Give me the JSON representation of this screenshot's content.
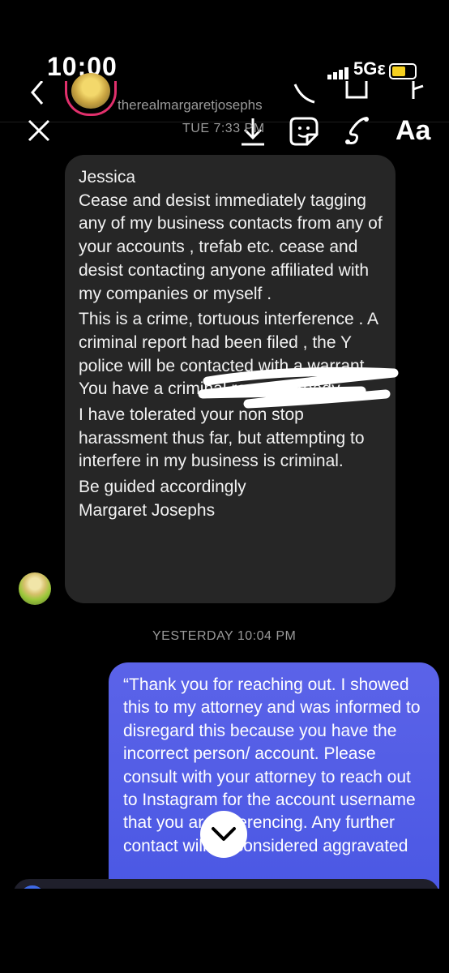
{
  "status_bar": {
    "time": "10:00",
    "network": "5Gε",
    "battery_fraction": 0.6
  },
  "header": {
    "username": "therealmargaretjosephs"
  },
  "story_tools": {
    "text_tool": "Aa"
  },
  "timestamps": {
    "first": "TUE 7:33 PM",
    "second": "YESTERDAY 10:04 PM"
  },
  "incoming_message": {
    "paragraphs": [
      "Jessica",
      "Cease and desist immediately tagging any of my business contacts from any of your accounts , trefab etc. cease and desist contacting anyone affiliated with my companies or myself .",
      "This is a crime, tortuous interference . A criminal report had been filed , the Y      police will be contacted with a warrant . You have a criminal record already .",
      "I have tolerated your non stop harassment thus far, but attempting to interfere in my business is criminal.",
      "Be guided accordingly\nMargaret Josephs"
    ]
  },
  "outgoing_message": {
    "text": "“Thank you for reaching out. I showed this to my attorney and was informed to disregard this because you have the incorrect person/ account. Please consult with your attorney to reach out to Instagram for the account username that you are referencing. Any further contact will be considered aggravated"
  },
  "colors": {
    "incoming_bubble": "#262626",
    "outgoing_bubble": "#4b58e4",
    "background": "#000000",
    "muted_text": "#9a9a9a"
  },
  "icons": [
    "back-chevron-icon",
    "close-icon",
    "download-icon",
    "sticker-icon",
    "draw-icon",
    "text-icon",
    "scroll-down-chevron-icon"
  ]
}
